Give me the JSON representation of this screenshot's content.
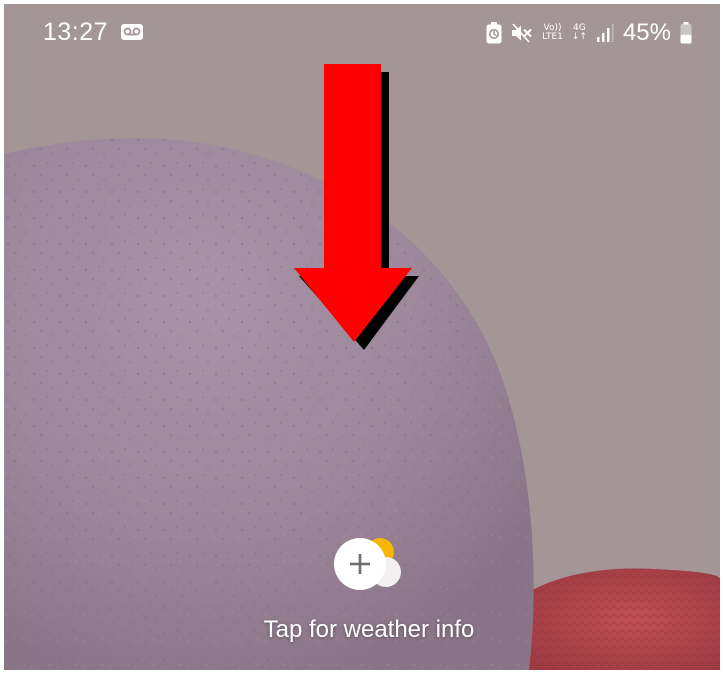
{
  "status_bar": {
    "time": "13:27",
    "network_volte": "Vo))\nLTE1",
    "network_type": "4G\n↓↑",
    "battery_percent": "45%",
    "battery_level": 0.45,
    "icons": [
      "voicemail-icon",
      "battery-saver-icon",
      "mute-icon",
      "volte-icon",
      "mobile-data-icon",
      "signal-icon",
      "battery-icon"
    ]
  },
  "overlay": {
    "arrow_icon": "down-arrow-icon",
    "arrow_color": "#ff0000"
  },
  "weather": {
    "label": "Tap for weather info",
    "icon": "add-weather-icon",
    "sun_color": "#f7b500"
  },
  "colors": {
    "background": "#a49596",
    "sphere": "#a08b9b",
    "cushion": "#b4484e"
  }
}
